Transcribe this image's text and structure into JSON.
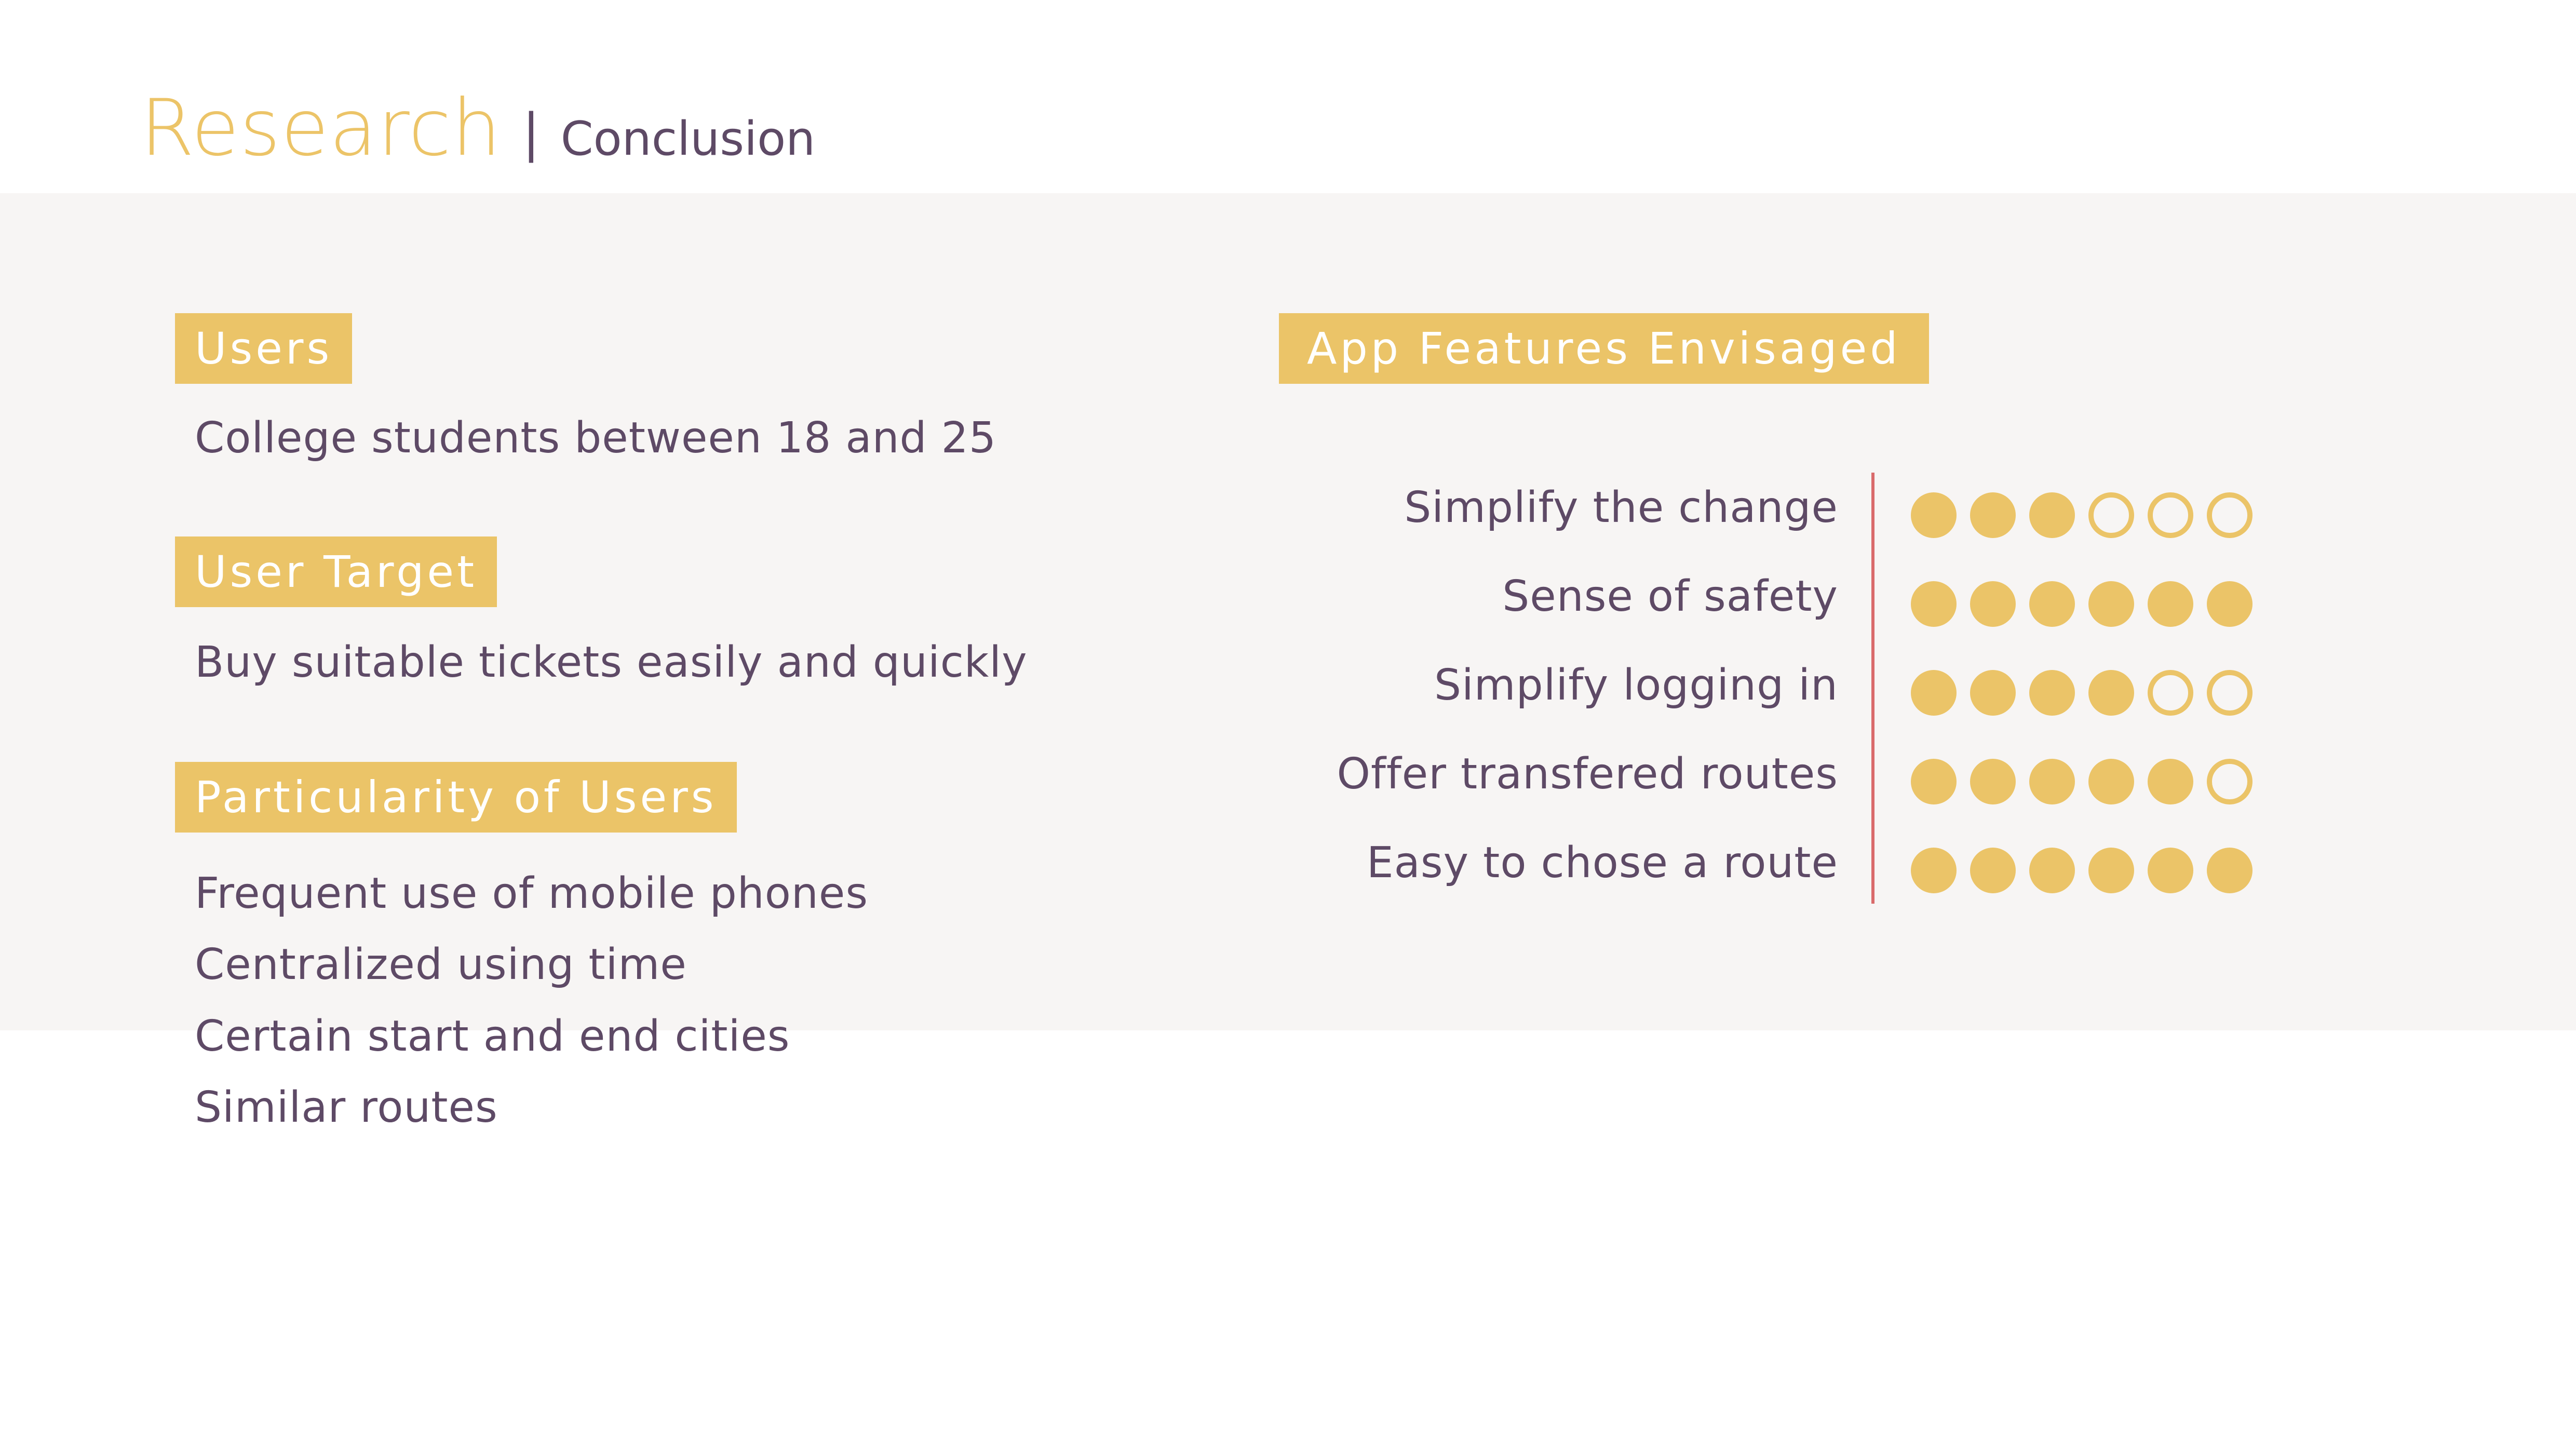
{
  "header": {
    "title": "Research",
    "separator": "|",
    "subtitle": "Conclusion"
  },
  "left": {
    "users": {
      "tag": "Users",
      "text": "College students between 18 and 25"
    },
    "user_target": {
      "tag": "User Target",
      "text": "Buy suitable tickets easily and quickly"
    },
    "particularity": {
      "tag": "Particularity of Users",
      "items": [
        "Frequent use of mobile phones",
        "Centralized using time",
        "Certain start and end cities",
        "Similar routes"
      ]
    }
  },
  "right": {
    "tag": "App Features Envisaged",
    "max_rating": 6,
    "features": [
      {
        "label": "Simplify the change",
        "rating": 3
      },
      {
        "label": "Sense of safety",
        "rating": 6
      },
      {
        "label": "Simplify logging in",
        "rating": 4
      },
      {
        "label": "Offer transfered routes",
        "rating": 5
      },
      {
        "label": "Easy to chose a route",
        "rating": 6
      }
    ]
  },
  "colors": {
    "accent": "#ebc468",
    "text": "#5e4a66",
    "divider": "#d96b6b",
    "panel_bg": "#f7f5f4"
  },
  "icons": {
    "filled_dot": "filled-circle",
    "empty_dot": "hollow-circle"
  }
}
